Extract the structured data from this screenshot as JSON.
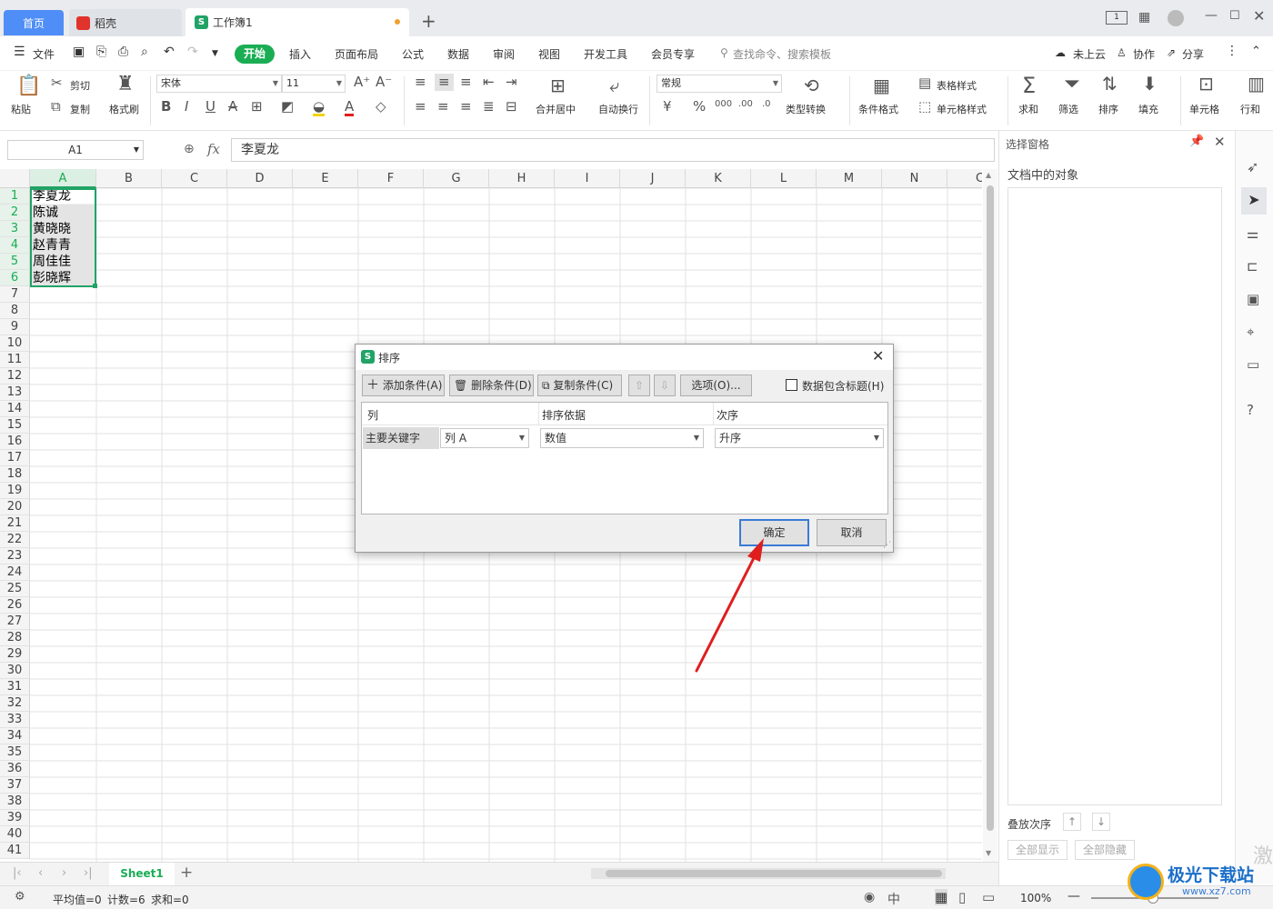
{
  "tabs": {
    "home": "首页",
    "daoke": "稻壳",
    "book": "工作簿1",
    "add": "+"
  },
  "menu": {
    "file": "文件",
    "start": "开始",
    "items": [
      "插入",
      "页面布局",
      "公式",
      "数据",
      "审阅",
      "视图",
      "开发工具",
      "会员专享"
    ],
    "search": "查找命令、搜索模板",
    "cloud": "未上云",
    "collab": "协作",
    "share": "分享"
  },
  "ribbon": {
    "paste": "粘贴",
    "cut": "剪切",
    "copy": "复制",
    "format_painter": "格式刷",
    "font_name": "宋体",
    "font_size": "11",
    "merge": "合并居中",
    "wrap": "自动换行",
    "number_format": "常规",
    "type_convert": "类型转换",
    "cond_format": "条件格式",
    "table_style": "表格样式",
    "cell_style": "单元格样式",
    "sum": "求和",
    "filter": "筛选",
    "sort": "排序",
    "fill": "填充",
    "cell": "单元格",
    "rowcol": "行和"
  },
  "formula": {
    "name_box": "A1",
    "fx": "fx",
    "value": "李夏龙"
  },
  "grid": {
    "columns": [
      "A",
      "B",
      "C",
      "D",
      "E",
      "F",
      "G",
      "H",
      "I",
      "J",
      "K",
      "L",
      "M",
      "N",
      "C"
    ],
    "rows": [
      "1",
      "2",
      "3",
      "4",
      "5",
      "6",
      "7",
      "8",
      "9",
      "10",
      "11",
      "12",
      "13",
      "14",
      "15",
      "16",
      "17",
      "18",
      "19",
      "20",
      "21",
      "22",
      "23",
      "24",
      "25",
      "26",
      "27",
      "28",
      "29",
      "30",
      "31",
      "32",
      "33",
      "34",
      "35",
      "36",
      "37",
      "38",
      "39",
      "40",
      "41"
    ],
    "cells_a": [
      "李夏龙",
      "陈诚",
      "黄晓晓",
      "赵青青",
      "周佳佳",
      "彭晓辉"
    ]
  },
  "sheet": {
    "name": "Sheet1",
    "add": "+"
  },
  "status": {
    "avg": "平均值=0",
    "count": "计数=6",
    "sum": "求和=0",
    "zoom": "100%"
  },
  "pane": {
    "title": "选择窗格",
    "objects": "文档中的对象",
    "order": "叠放次序",
    "show_all": "全部显示",
    "hide_all": "全部隐藏"
  },
  "dialog": {
    "title": "排序",
    "add_condition": "添加条件(A)",
    "delete_condition": "删除条件(D)",
    "copy_condition": "复制条件(C)",
    "options": "选项(O)...",
    "has_header": "数据包含标题(H)",
    "col_header": "列",
    "basis_header": "排序依据",
    "order_header": "次序",
    "row_label": "主要关键字",
    "column_value": "列 A",
    "basis_value": "数值",
    "order_value": "升序",
    "ok": "确定",
    "cancel": "取消"
  },
  "watermark": {
    "site": "极光下载站",
    "domain": "www.xz7.com",
    "partial": "激"
  }
}
